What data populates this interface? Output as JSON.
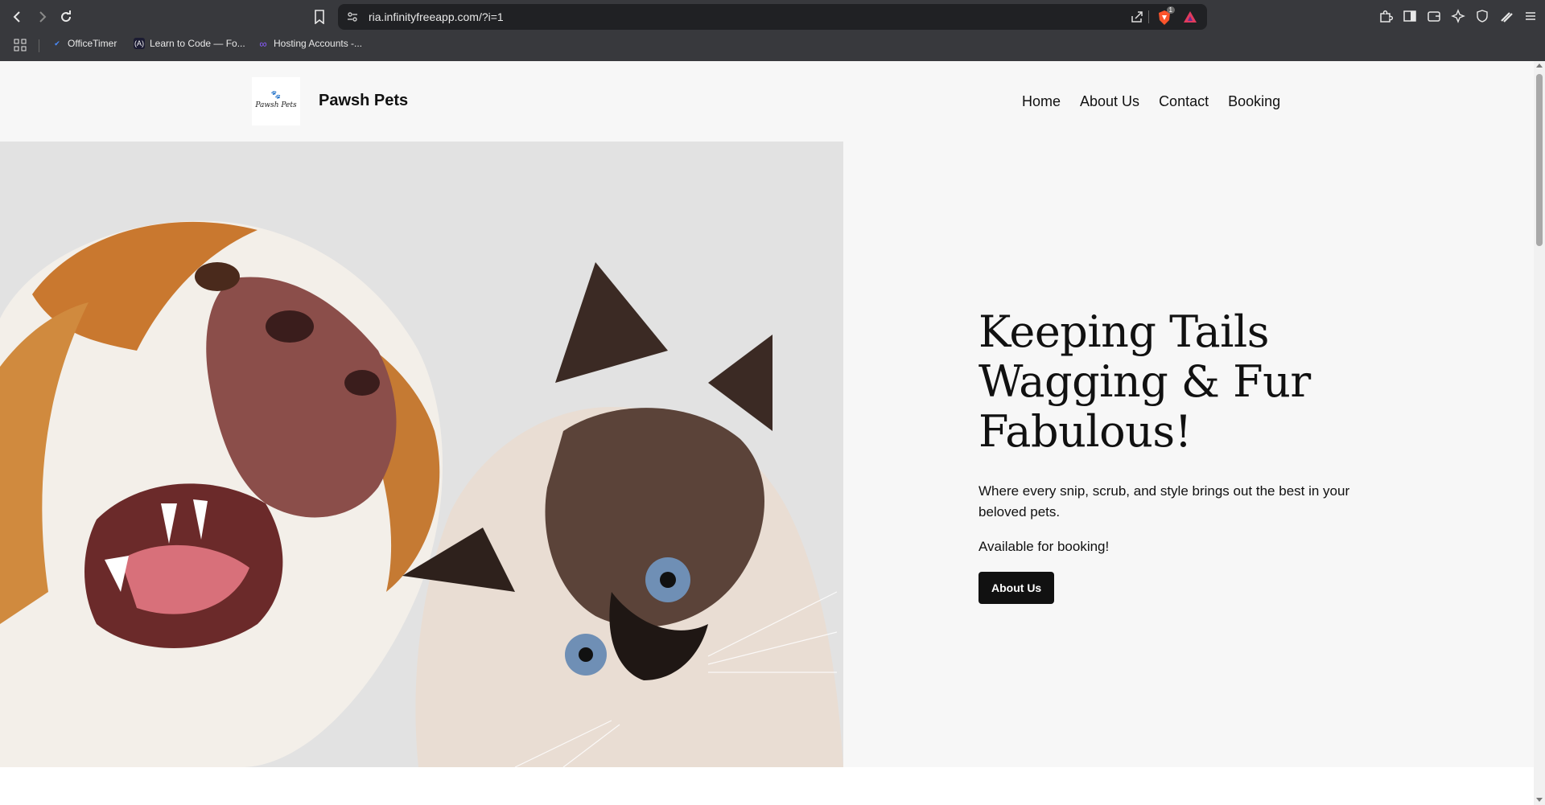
{
  "browser": {
    "url": "ria.infinityfreeapp.com/?i=1",
    "shield_badge": "1",
    "bookmarks": [
      {
        "label": "OfficeTimer",
        "icon": "check-icon",
        "color": "#4a8cff"
      },
      {
        "label": "Learn to Code — Fo...",
        "icon": "freecodecamp-icon",
        "color": "#1b1b32"
      },
      {
        "label": "Hosting Accounts -...",
        "icon": "infinity-icon",
        "color": "#8a5cff"
      }
    ]
  },
  "site": {
    "title": "Pawsh Pets",
    "logo_text": "Pawsh Pets",
    "nav": [
      "Home",
      "About Us",
      "Contact",
      "Booking"
    ]
  },
  "hero": {
    "title_line1": "Keeping Tails",
    "title_line2": "Wagging & Fur",
    "title_line3": "Fabulous!",
    "description": "Where every snip, scrub, and style brings out the best in your beloved pets.",
    "availability": "Available for booking!",
    "button_label": "About Us",
    "image_alt": "dog-and-cat-photo"
  }
}
